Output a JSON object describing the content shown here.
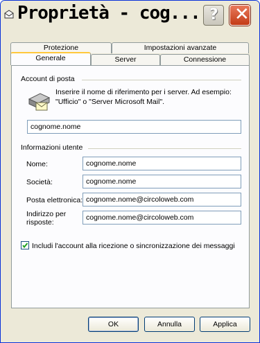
{
  "window": {
    "title": "Proprietà - cog...",
    "help_glyph": "?",
    "close_glyph": "✕"
  },
  "tabs": {
    "row_back": [
      "Protezione",
      "Impostazioni avanzate"
    ],
    "row_front": [
      "Generale",
      "Server",
      "Connessione"
    ],
    "active": "Generale"
  },
  "mail_account": {
    "group_label": "Account di posta",
    "description": "Inserire il nome di riferimento per i server. Ad esempio: \"Ufficio\" o \"Server Microsoft Mail\".",
    "account_name": "cognome.nome"
  },
  "user_info": {
    "group_label": "Informazioni utente",
    "name_label": "Nome:",
    "name_value": "cognome.nome",
    "company_label": "Società:",
    "company_value": "cognome.nome",
    "email_label": "Posta elettronica:",
    "email_value": "cognome.nome@circoloweb.com",
    "reply_label_line1": "Indirizzo per",
    "reply_label_line2": "risposte:",
    "reply_value": "cognome.nome@circoloweb.com"
  },
  "include_account": {
    "checked": true,
    "label": "Includi l'account alla ricezione o sincronizzazione dei messaggi"
  },
  "buttons": {
    "ok": "OK",
    "cancel": "Annulla",
    "apply": "Applica"
  },
  "colors": {
    "active_tab_accent": "#ffc83c",
    "close_button": "#c33b16",
    "checkmark": "#21a121"
  }
}
